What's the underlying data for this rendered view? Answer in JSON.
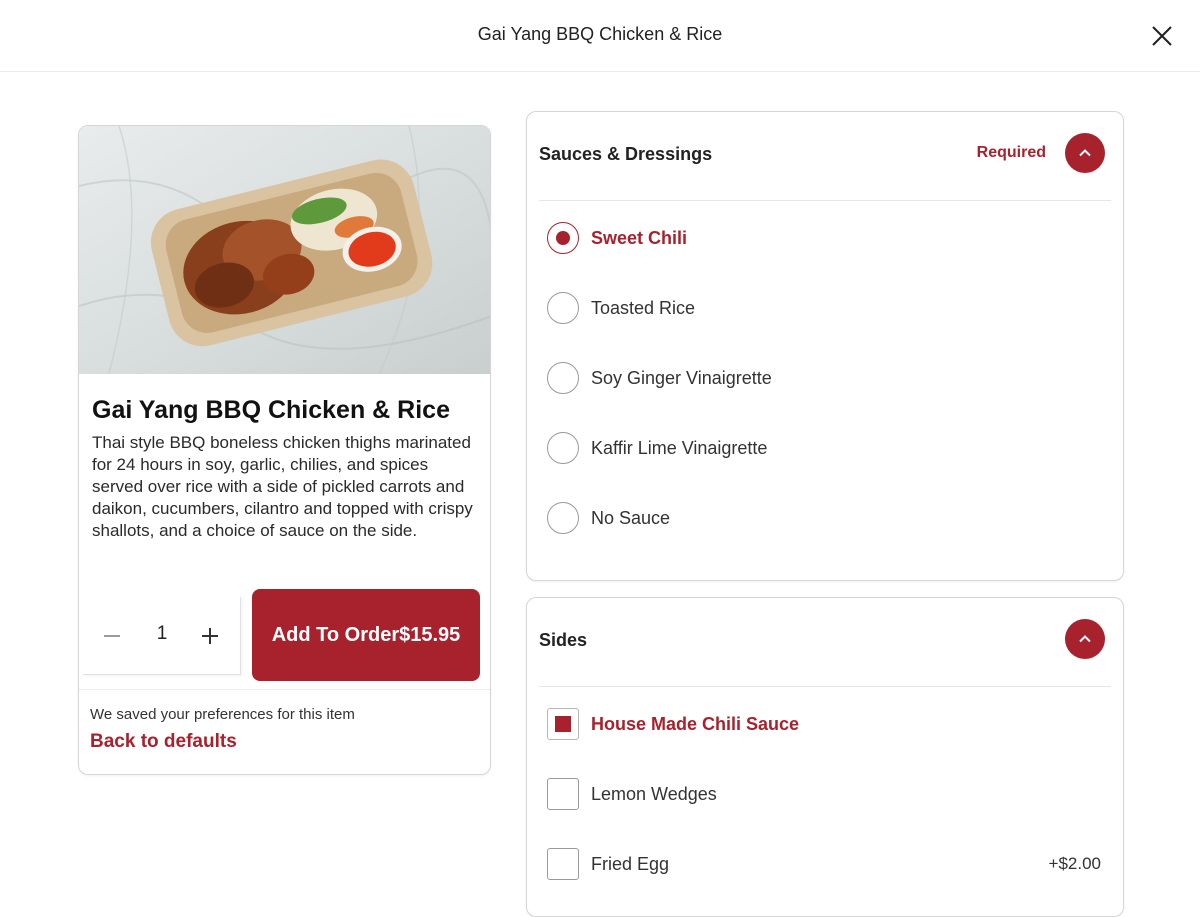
{
  "header": {
    "title": "Gai Yang BBQ Chicken & Rice"
  },
  "product": {
    "name": "Gai Yang BBQ Chicken & Rice",
    "description": "Thai style BBQ boneless chicken thighs marinated for 24 hours in soy, garlic, chilies, and spices served over rice with a side of pickled carrots and daikon, cucumbers, cilantro and topped with crispy shallots, and a choice of sauce on the side.",
    "quantity": "1",
    "add_button_label": "Add To Order",
    "price": "$15.95",
    "saved_note": "We saved your preferences for this item",
    "back_to_defaults": "Back to defaults"
  },
  "sauces": {
    "title": "Sauces & Dressings",
    "required_label": "Required",
    "options": [
      {
        "label": "Sweet Chili",
        "selected": true
      },
      {
        "label": "Toasted Rice",
        "selected": false
      },
      {
        "label": "Soy Ginger Vinaigrette",
        "selected": false
      },
      {
        "label": "Kaffir Lime Vinaigrette",
        "selected": false
      },
      {
        "label": "No Sauce",
        "selected": false
      }
    ]
  },
  "sides": {
    "title": "Sides",
    "options": [
      {
        "label": "House Made Chili Sauce",
        "checked": true,
        "price": ""
      },
      {
        "label": "Lemon Wedges",
        "checked": false,
        "price": ""
      },
      {
        "label": "Fried Egg",
        "checked": false,
        "price": "+$2.00"
      }
    ]
  },
  "colors": {
    "accent": "#a8222e",
    "border": "#d6d6d6",
    "text": "#222222"
  },
  "icons": {
    "close": "close-icon",
    "collapse": "chevron-up-icon",
    "minus": "minus-icon",
    "plus": "plus-icon"
  }
}
